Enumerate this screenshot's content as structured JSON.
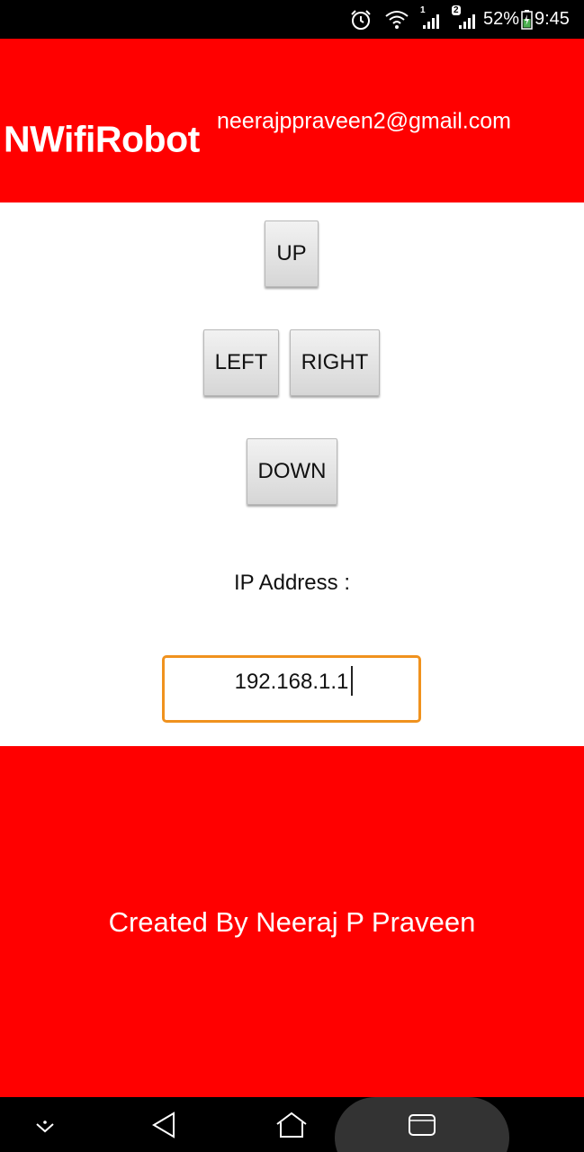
{
  "status_bar": {
    "alarm_icon": "alarm-clock-icon",
    "wifi_icon": "wifi-icon",
    "sim1_badge": "1",
    "sim2_badge": "2",
    "battery_percent": "52%",
    "time": "9:45"
  },
  "header": {
    "title": "NWifiRobot",
    "email": "neerajppraveen2@gmail.com",
    "background_color": "#ff0000"
  },
  "controls": {
    "up_label": "UP",
    "left_label": "LEFT",
    "right_label": "RIGHT",
    "down_label": "DOWN"
  },
  "ip": {
    "label": "IP Address :",
    "value": "192.168.1.1",
    "focus_color": "#f0921e"
  },
  "footer": {
    "credit": "Created By Neeraj P Praveen",
    "background_color": "#ff0000"
  },
  "nav_bar": {
    "hide_keyboard_icon": "chevron-down-icon",
    "back_icon": "back-triangle-icon",
    "home_icon": "home-icon",
    "recent_apps_icon": "recent-apps-icon"
  }
}
